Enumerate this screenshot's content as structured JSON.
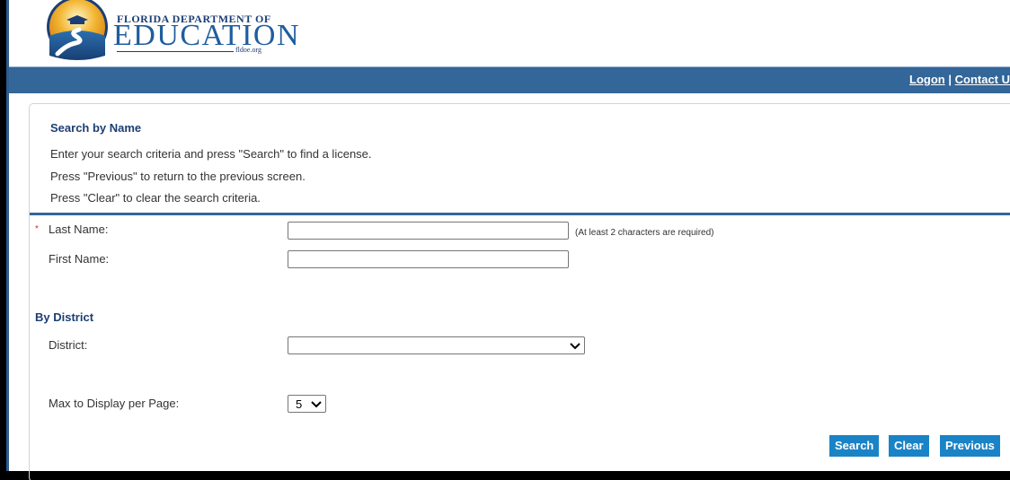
{
  "header": {
    "logo": {
      "line1": "FLORIDA DEPARTMENT OF",
      "line2": "EDUCATION",
      "site": "fldoe.org"
    },
    "nav": {
      "logon": "Logon",
      "separator": "|",
      "contact": "Contact U"
    },
    "nav_color": "#336699"
  },
  "search_panel": {
    "title": "Search by Name",
    "instructions": [
      "Enter your search criteria and press \"Search\" to find a license.",
      "Press \"Previous\" to return to the previous screen.",
      "Press \"Clear\" to clear the search criteria."
    ],
    "fields": {
      "last_name": {
        "label": "Last Name:",
        "required": true,
        "required_mark": "*",
        "value": "",
        "hint": "(At least 2 characters are required)"
      },
      "first_name": {
        "label": "First Name:",
        "value": ""
      }
    },
    "district_section": {
      "title": "By District",
      "district": {
        "label": "District:",
        "selected": ""
      }
    },
    "max_display": {
      "label": "Max to Display per Page:",
      "selected": "5"
    },
    "buttons": {
      "search": "Search",
      "clear": "Clear",
      "previous": "Previous"
    },
    "button_color": "#1a83c6"
  }
}
